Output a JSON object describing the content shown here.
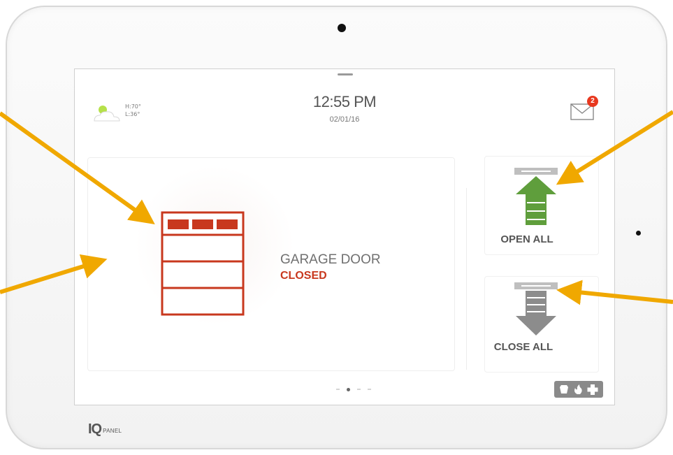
{
  "header": {
    "time": "12:55 PM",
    "date": "02/01/16"
  },
  "weather": {
    "high": "H:70°",
    "low": "L:36°",
    "icon": "partly-sunny-icon"
  },
  "messages": {
    "icon": "envelope-icon",
    "unread_count": "2"
  },
  "garage": {
    "name": "GARAGE DOOR",
    "status": "CLOSED",
    "status_color": "#c8381e",
    "icon": "garage-door-icon"
  },
  "actions": {
    "open_all": {
      "label": "OPEN ALL",
      "icon": "garage-open-icon",
      "color": "#5f9e3c"
    },
    "close_all": {
      "label": "CLOSE ALL",
      "icon": "garage-close-icon",
      "color": "#8c8c8c"
    }
  },
  "pager": {
    "pages": 4,
    "active": 2
  },
  "emergency": {
    "icons": [
      "police-icon",
      "fire-icon",
      "medical-cross-icon"
    ]
  },
  "brand": {
    "logo_main": "IQ",
    "logo_sub": "PANEL"
  },
  "annotation_color": "#f0a800"
}
